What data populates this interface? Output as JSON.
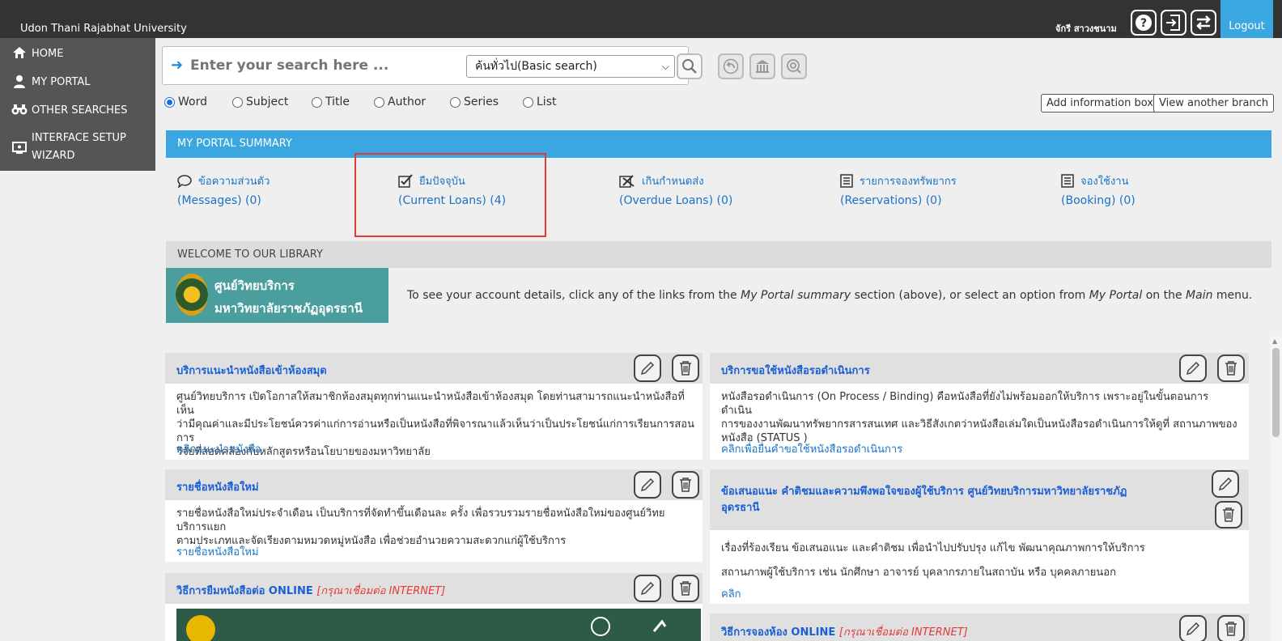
{
  "header": {
    "university": "Udon Thani Rajabhat University",
    "username": "จักรี สาวงชนาม",
    "logout": "Logout",
    "icons": [
      "help-icon",
      "login-icon",
      "switch-icon"
    ]
  },
  "sidebar": {
    "items": [
      {
        "label": "HOME",
        "icon": "home-icon"
      },
      {
        "label": "MY PORTAL",
        "icon": "user-icon"
      },
      {
        "label": "OTHER SEARCHES",
        "icon": "binoculars-icon"
      },
      {
        "label": "INTERFACE SETUP WIZARD",
        "icon": "monitor-icon"
      }
    ]
  },
  "search": {
    "placeholder": "Enter your search here ...",
    "value": "",
    "type_selected": "ค้นทั่วไป(Basic search)",
    "options": [
      "Word",
      "Subject",
      "Title",
      "Author",
      "Series",
      "List"
    ],
    "selected_option": "Word"
  },
  "buttons": {
    "add_info_box": "Add information box",
    "view_branch": "View another branch"
  },
  "summary": {
    "header": "MY PORTAL SUMMARY",
    "items": [
      {
        "thai": "ข้อความส่วนตัว",
        "english": "(Messages)  (0)",
        "icon": "message-icon"
      },
      {
        "thai": "ยืมปัจจุบัน",
        "english": "(Current Loans)  (4)",
        "icon": "checkbox-icon"
      },
      {
        "thai": "เกินกำหนดส่ง",
        "english": "(Overdue Loans)  (0)",
        "icon": "overdue-icon"
      },
      {
        "thai": "รายการจองทรัพยากร",
        "english": "(Reservations)  (0)",
        "icon": "list-icon"
      },
      {
        "thai": "จองใช้งาน",
        "english": "(Booking)  (0)",
        "icon": "booking-icon"
      }
    ]
  },
  "welcome": {
    "header": "WELCOME TO OUR LIBRARY",
    "logo_line1": "ศูนย์วิทยบริการ",
    "logo_line2": "มหาวิทยาลัยราชภัฏอุดรธานี",
    "text_a": "To see your account details, click any of the links from the ",
    "text_b": "My Portal summary",
    "text_c": " section (above), or select an option from ",
    "text_d": "My Portal",
    "text_e": " on the ",
    "text_f": "Main",
    "text_g": " menu."
  },
  "cards": {
    "c1": {
      "title": "บริการแนะนำหนังสือเข้าห้องสมุด",
      "lines": [
        "ศูนย์วิทยบริการ เปิดโอกาสให้สมาชิกห้องสมุดทุกท่านแนะนำหนังสือเข้าห้องสมุด โดยท่านสามารถแนะนำหนังสือที่เห็น",
        "ว่ามีคุณค่าและมีประโยชน์ควรค่าแก่การอ่านหรือเป็นหนังสือที่พิจารณาแล้วเห็นว่าเป็นประโยชน์แก่การเรียนการสอน การ",
        "วิจัยที่สอดคล้องกับหลักสูตรหรือนโยบายของมหาวิทยาลัย"
      ],
      "link": "คลิกแนะนำหนังสือ"
    },
    "c2": {
      "title": "บริการขอใช้หนังสือรอดำเนินการ",
      "lines": [
        "หนังสือรอดำเนินการ (On Process / Binding) คือหนังสือที่ยังไม่พร้อมออกให้บริการ เพราะอยู่ในขั้นตอนการดำเนิน",
        "การของงานพัฒนาทรัพยากรสารสนเทศ และวิธีสังเกตว่าหนังสือเล่มใดเป็นหนังสือรอดำเนินการให้ดูที่ สถานภาพของ",
        "หนังสือ (STATUS )"
      ],
      "link": "คลิกเพื่อยื่นคำขอใช้หนังสือรอดำเนินการ"
    },
    "c3": {
      "title": "รายชื่อหนังสือใหม่",
      "lines": [
        "รายชื่อหนังสือใหม่ประจำเดือน เป็นบริการที่จัดทำขึ้นเดือนละ ครั้ง เพื่อรวบรวมรายชื่อหนังสือใหม่ของศูนย์วิทยบริการแยก",
        "ตามประเภทและจัดเรียงตามหมวดหมู่หนังสือ เพื่อช่วยอำนวยความสะดวกแก่ผู้ใช้บริการ"
      ],
      "link": "รายชื่อหนังสือใหม่"
    },
    "c4": {
      "title_line1": "ข้อเสนอแนะ คำติชมและความพึงพอใจของผู้ใช้บริการ ศูนย์วิทยบริการมหาวิทยาลัยราชภัฏ",
      "title_line2": "อุดรธานี",
      "lines": [
        "เรื่องที่ร้องเรียน ข้อเสนอแนะ และคำติชม เพื่อนำไปปรับปรุง แก้ไข พัฒนาคุณภาพการให้บริการ",
        "สถานภาพผู้ใช้บริการ เช่น นักศึกษา อาจารย์ บุคลากรภายในสถาบัน หรือ บุคคลภายนอก"
      ],
      "link": "คลิก"
    },
    "c5": {
      "title": "วิธีการยืมหนังสือต่อ ONLINE ",
      "note": "[กรุณาเชื่อมต่อ INTERNET]"
    },
    "c6": {
      "title": "วิธีการจองห้อง ONLINE ",
      "note": "[กรุณาเชื่อมต่อ INTERNET]"
    }
  },
  "colors": {
    "topbar": "#333333",
    "sidebar": "#555555",
    "accent": "#3aa7e0",
    "link": "#1a73c7",
    "highlight": "#e53935"
  }
}
